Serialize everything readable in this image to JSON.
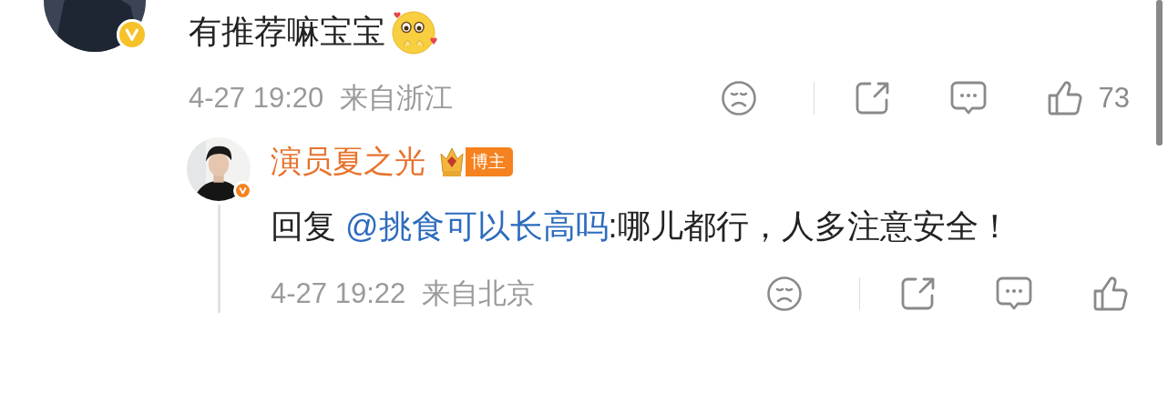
{
  "comments": [
    {
      "kind": "comment",
      "verified": true,
      "color": "#f5c22a",
      "text": "有推荐嘛宝宝",
      "time": "4-27 19:20",
      "location": "来自浙江",
      "likes": "73"
    },
    {
      "kind": "reply",
      "verified": true,
      "color": "#f5821f",
      "name": "演员夏之光",
      "badge": "博主",
      "prefix": "回复",
      "mention": "@挑食可以长高吗",
      "text": ":哪儿都行，人多注意安全！",
      "time": "4-27 19:22",
      "location": "来自北京"
    }
  ]
}
